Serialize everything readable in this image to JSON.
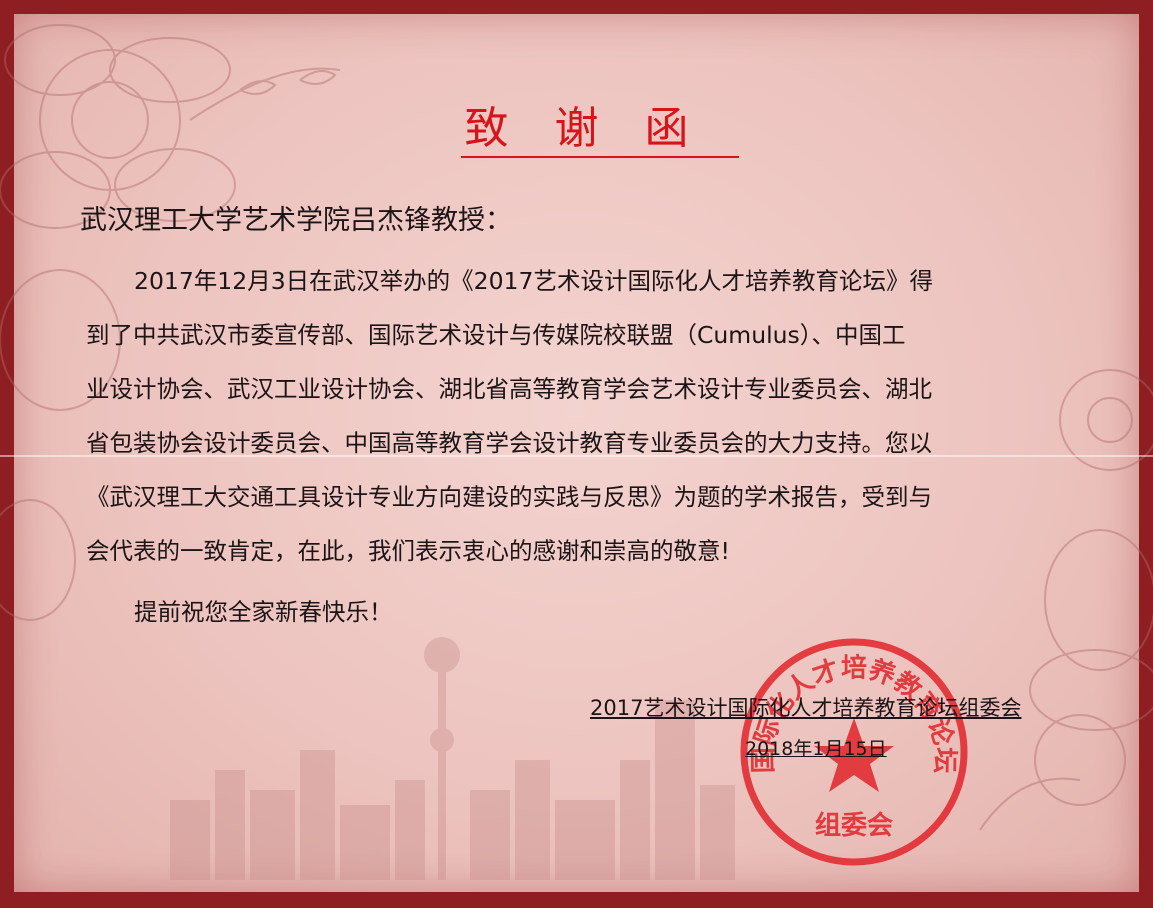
{
  "letter": {
    "title": "致谢函",
    "recipient": "武汉理工大学艺术学院吕杰锋教授：",
    "body_lines": [
      "2017年12月3日在武汉举办的《2017艺术设计国际化人才培养教育论坛》得",
      "到了中共武汉市委宣传部、国际艺术设计与传媒院校联盟（Cumulus）、中国工",
      "业设计协会、武汉工业设计协会、湖北省高等教育学会艺术设计专业委员会、湖北",
      "省包装协会设计委员会、中国高等教育学会设计教育专业委员会的大力支持。您以",
      "《武汉理工大交通工具设计专业方向建设的实践与反思》为题的学术报告，受到与",
      "会代表的一致肯定，在此，我们表示衷心的感谢和崇高的敬意!"
    ],
    "greeting": "提前祝您全家新春快乐！",
    "organizer": "2017艺术设计国际化人才培养教育论坛组委会",
    "date": "2018年1月15日"
  },
  "seal": {
    "text": "国际化人才培养教育论坛",
    "bottom": "组委会",
    "icon": "star-icon",
    "color": "#e0232a"
  },
  "colors": {
    "border": "#8f1e22",
    "title": "#d8141b",
    "paper": "#f0ccc8"
  }
}
